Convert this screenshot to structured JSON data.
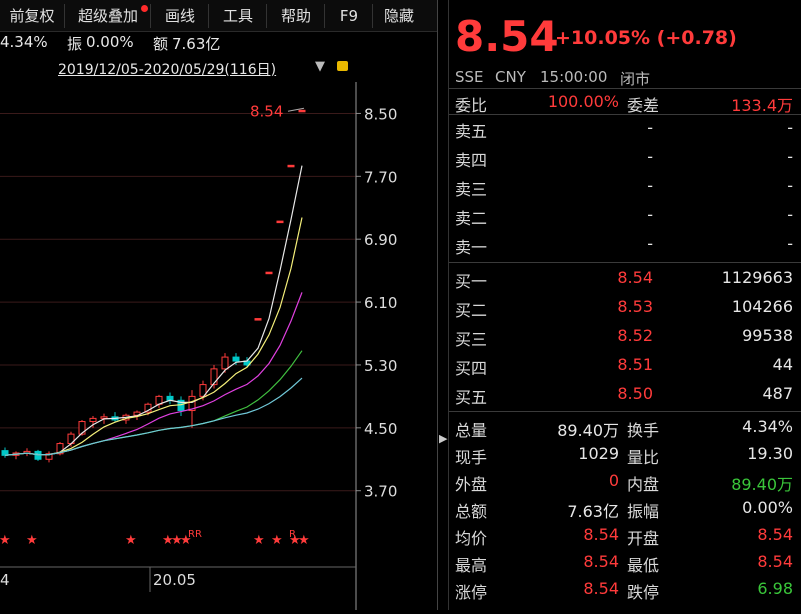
{
  "toolbar": {
    "buttons": [
      "前复权",
      "超级叠加",
      "画线",
      "工具",
      "帮助",
      "F9",
      "隐藏"
    ]
  },
  "chart_info": {
    "turnover": "4.34%",
    "amplitude_label": "振",
    "amplitude": "0.00%",
    "amount_label": "额",
    "amount": "7.63亿"
  },
  "range": {
    "text": "2019/12/05-2020/05/29(116日)"
  },
  "chart_data": {
    "type": "candlestick",
    "y_ticks": [
      "8.50",
      "7.70",
      "6.90",
      "6.10",
      "5.30",
      "4.50",
      "3.70"
    ],
    "ylim": [
      3.2,
      8.9
    ],
    "x_tick_labels": [
      "4",
      "20.05"
    ],
    "last_price_label": "8.54",
    "marker_labels": [
      "RR",
      "R"
    ],
    "candles": [
      {
        "o": 4.21,
        "h": 4.25,
        "l": 4.12,
        "c": 4.15
      },
      {
        "o": 4.15,
        "h": 4.2,
        "l": 4.1,
        "c": 4.18
      },
      {
        "o": 4.18,
        "h": 4.24,
        "l": 4.14,
        "c": 4.2
      },
      {
        "o": 4.2,
        "h": 4.22,
        "l": 4.08,
        "c": 4.1
      },
      {
        "o": 4.1,
        "h": 4.2,
        "l": 4.06,
        "c": 4.17
      },
      {
        "o": 4.17,
        "h": 4.32,
        "l": 4.15,
        "c": 4.3
      },
      {
        "o": 4.3,
        "h": 4.45,
        "l": 4.26,
        "c": 4.42
      },
      {
        "o": 4.42,
        "h": 4.6,
        "l": 4.4,
        "c": 4.58
      },
      {
        "o": 4.58,
        "h": 4.65,
        "l": 4.5,
        "c": 4.62
      },
      {
        "o": 4.62,
        "h": 4.68,
        "l": 4.55,
        "c": 4.64
      },
      {
        "o": 4.64,
        "h": 4.7,
        "l": 4.58,
        "c": 4.6
      },
      {
        "o": 4.6,
        "h": 4.68,
        "l": 4.55,
        "c": 4.66
      },
      {
        "o": 4.66,
        "h": 4.72,
        "l": 4.6,
        "c": 4.7
      },
      {
        "o": 4.7,
        "h": 4.82,
        "l": 4.66,
        "c": 4.8
      },
      {
        "o": 4.8,
        "h": 4.92,
        "l": 4.75,
        "c": 4.9
      },
      {
        "o": 4.9,
        "h": 4.95,
        "l": 4.8,
        "c": 4.85
      },
      {
        "o": 4.85,
        "h": 4.9,
        "l": 4.65,
        "c": 4.72
      },
      {
        "o": 4.72,
        "h": 4.98,
        "l": 4.5,
        "c": 4.9
      },
      {
        "o": 4.9,
        "h": 5.1,
        "l": 4.85,
        "c": 5.05
      },
      {
        "o": 5.05,
        "h": 5.3,
        "l": 5.0,
        "c": 5.25
      },
      {
        "o": 5.25,
        "h": 5.45,
        "l": 5.2,
        "c": 5.4
      },
      {
        "o": 5.4,
        "h": 5.45,
        "l": 5.3,
        "c": 5.35
      },
      {
        "o": 5.35,
        "h": 5.4,
        "l": 5.28,
        "c": 5.3
      },
      {
        "o": 5.89,
        "h": 5.89,
        "l": 5.89,
        "c": 5.89
      },
      {
        "o": 6.48,
        "h": 6.48,
        "l": 6.48,
        "c": 6.48
      },
      {
        "o": 7.13,
        "h": 7.13,
        "l": 7.13,
        "c": 7.13
      },
      {
        "o": 7.84,
        "h": 7.84,
        "l": 7.84,
        "c": 7.84
      },
      {
        "o": 8.54,
        "h": 8.54,
        "l": 8.54,
        "c": 8.54
      }
    ]
  },
  "quote": {
    "price": "8.54",
    "change": "+10.05% (+0.78)",
    "market": "SSE",
    "currency": "CNY",
    "time": "15:00:00",
    "status": "闭市",
    "weibi_label": "委比",
    "weibi": "100.00%",
    "weicha_label": "委差",
    "weicha": "133.4万",
    "asks": [
      {
        "label": "卖五",
        "price": "-",
        "vol": "-"
      },
      {
        "label": "卖四",
        "price": "-",
        "vol": "-"
      },
      {
        "label": "卖三",
        "price": "-",
        "vol": "-"
      },
      {
        "label": "卖二",
        "price": "-",
        "vol": "-"
      },
      {
        "label": "卖一",
        "price": "-",
        "vol": "-"
      }
    ],
    "bids": [
      {
        "label": "买一",
        "price": "8.54",
        "vol": "1129663"
      },
      {
        "label": "买二",
        "price": "8.53",
        "vol": "104266"
      },
      {
        "label": "买三",
        "price": "8.52",
        "vol": "99538"
      },
      {
        "label": "买四",
        "price": "8.51",
        "vol": "44"
      },
      {
        "label": "买五",
        "price": "8.50",
        "vol": "487"
      }
    ],
    "stats": [
      {
        "l1": "总量",
        "v1": "89.40万",
        "c1": "white",
        "l2": "换手",
        "v2": "4.34%",
        "c2": "white"
      },
      {
        "l1": "现手",
        "v1": "1029",
        "c1": "white",
        "l2": "量比",
        "v2": "19.30",
        "c2": "white"
      },
      {
        "l1": "外盘",
        "v1": "0",
        "c1": "red",
        "l2": "内盘",
        "v2": "89.40万",
        "c2": "green"
      },
      {
        "l1": "总额",
        "v1": "7.63亿",
        "c1": "white",
        "l2": "振幅",
        "v2": "0.00%",
        "c2": "white"
      },
      {
        "l1": "均价",
        "v1": "8.54",
        "c1": "red",
        "l2": "开盘",
        "v2": "8.54",
        "c2": "red"
      },
      {
        "l1": "最高",
        "v1": "8.54",
        "c1": "red",
        "l2": "最低",
        "v2": "8.54",
        "c2": "red"
      },
      {
        "l1": "涨停",
        "v1": "8.54",
        "c1": "red",
        "l2": "跌停",
        "v2": "6.98",
        "c2": "green"
      }
    ]
  },
  "colors": {
    "up": "#ff3b3b",
    "down": "#00c8c8",
    "ma_yellow": "#f5f07a",
    "ma_white": "#e8e8e8",
    "ma_magenta": "#e040e0",
    "ma_green": "#40c040",
    "ma_cyan": "#70c8d8"
  }
}
